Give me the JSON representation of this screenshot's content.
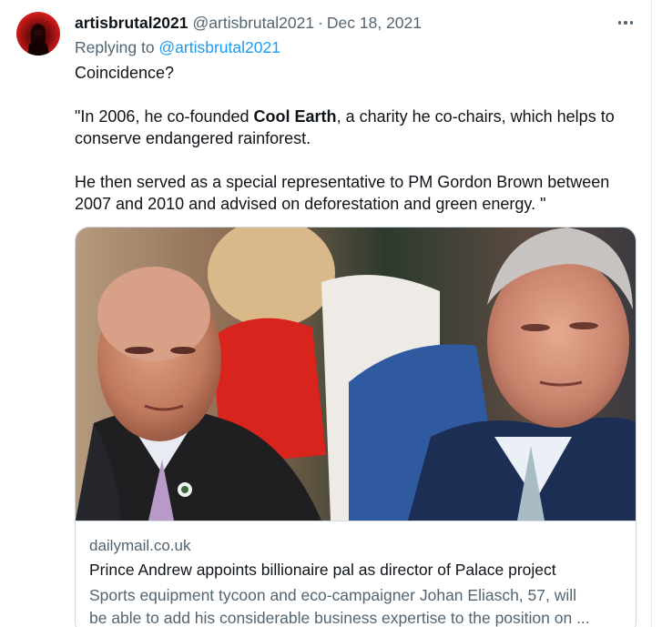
{
  "tweet": {
    "display_name": "artisbrutal2021",
    "handle": "@artisbrutal2021",
    "separator": "·",
    "date": "Dec 18, 2021",
    "replying_prefix": "Replying to ",
    "replying_handle": "@artisbrutal2021",
    "text": {
      "line1": "Coincidence?",
      "quote_line1_pre": "\"In 2006, he co-founded ",
      "quote_line1_bold": "Cool Earth",
      "quote_line1_post": ", a charity he co-chairs, which helps to",
      "quote_line2": "conserve endangered rainforest.",
      "quote_line3": "He then served as a special representative to PM Gordon Brown between",
      "quote_line4": "2007 and 2010 and advised on deforestation and green energy. \""
    }
  },
  "card": {
    "domain": "dailymail.co.uk",
    "title": "Prince Andrew appoints billionaire pal as director of Palace project",
    "description_line1": "Sports equipment tycoon and eco-campaigner Johan Eliasch, 57, will",
    "description_line2": "be able to add his considerable business expertise to the position on ..."
  },
  "icons": {
    "avatar": "avatar-icon",
    "more": "more-horizontal-icon"
  },
  "colors": {
    "link": "#1d9bf0",
    "secondary_text": "#536471",
    "primary_text": "#0f1419",
    "avatar_red": "#d01c1c"
  }
}
